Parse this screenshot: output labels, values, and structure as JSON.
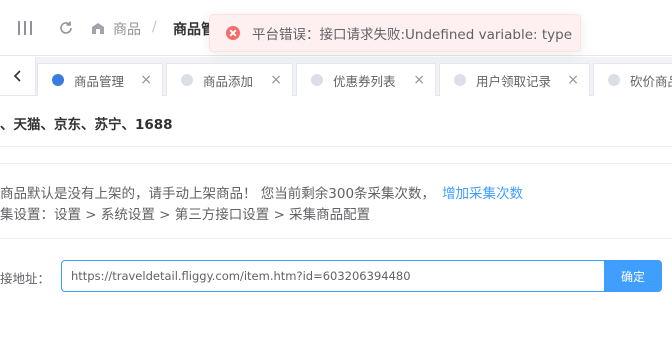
{
  "header": {
    "breadcrumb": [
      "商品",
      "商品管理"
    ],
    "breadcrumb_sep": "/"
  },
  "toast": {
    "type": "error",
    "message": "平台错误：接口请求失败:Undefined variable: type"
  },
  "tabs": {
    "items": [
      {
        "label": "商品管理",
        "active": true
      },
      {
        "label": "商品添加",
        "active": false
      },
      {
        "label": "优惠券列表",
        "active": false
      },
      {
        "label": "用户领取记录",
        "active": false
      },
      {
        "label": "砍价商品",
        "active": false
      }
    ],
    "close_glyph": "×"
  },
  "main": {
    "platforms_title": "、天猫、京东、苏宁、1688",
    "notice_text": "商品默认是没有上架的，请手动上架商品！ 您当前剩余300条采集次数，",
    "notice_link": "增加采集次数",
    "settings_path": "集设置：设置 > 系统设置 > 第三方接口设置 > 采集商品配置",
    "field_label": "接地址：",
    "url_value": "https://traveldetail.fliggy.com/item.htm?id=603206394480",
    "confirm_label": "确定"
  },
  "colors": {
    "primary": "#409eff",
    "error": "#f56c6c",
    "active_tab_dot": "#3a7be0"
  }
}
